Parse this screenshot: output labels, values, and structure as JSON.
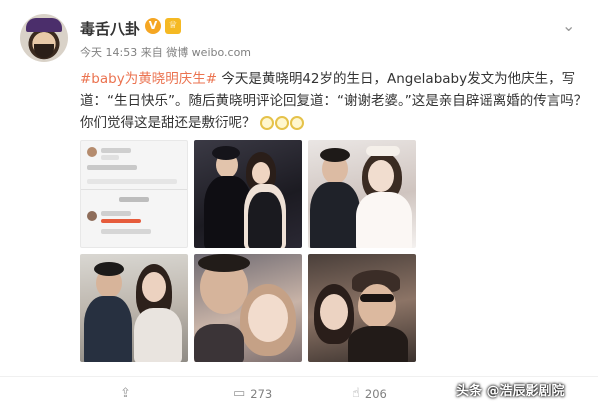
{
  "post": {
    "author": "毒舌八卦",
    "verified_badge": "V",
    "level_badge": "♕",
    "meta": "今天 14:53 来自 微博 weibo.com",
    "hashtag": "#baby为黄晓明庆生#",
    "text_1": "今天是黄晓明42岁的生日，Angelababy发文为他庆生，写道：“生日快乐”。随后黄晓明评论回复道：“谢谢老婆。”这是亲自辟谣离婚的传言吗？你们觉得这是甜还是敷衍呢？",
    "emoji": "doge-emoji-group"
  },
  "actions": {
    "forward_icon": "share-icon",
    "comment_icon": "comment-icon",
    "comment_count": "273",
    "like_icon": "like-icon",
    "like_count": "206"
  },
  "watermark": {
    "text": "头条 @浩辰影剧院"
  },
  "colors": {
    "hashtag": "#eb7350",
    "meta": "#808080",
    "verified": "#f5a623"
  }
}
